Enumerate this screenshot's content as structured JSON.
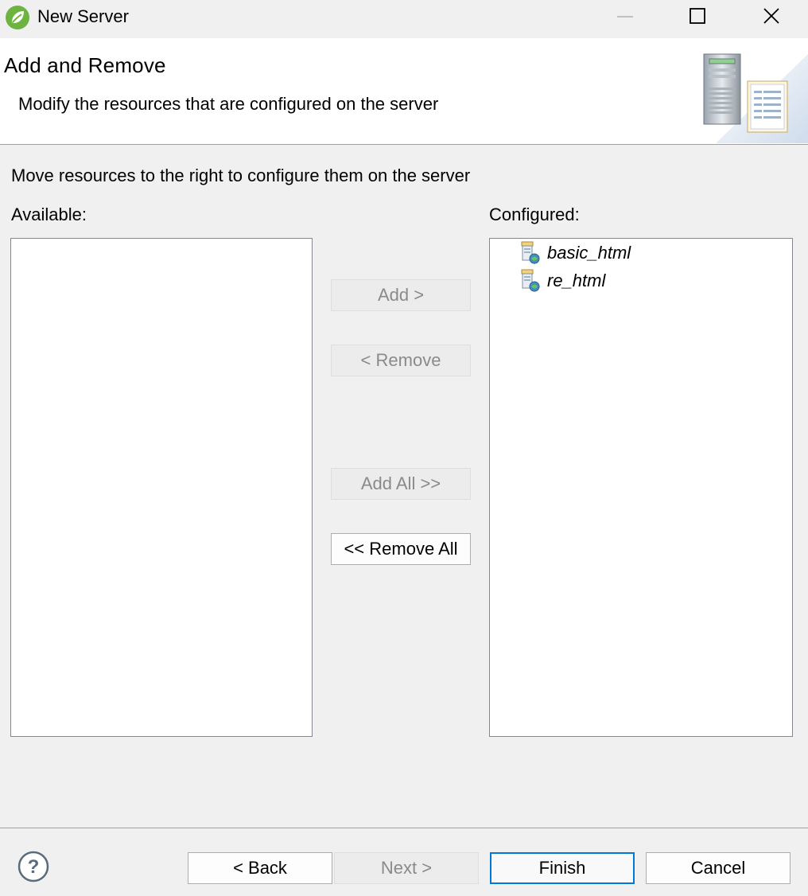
{
  "window": {
    "title": "New Server",
    "icons": {
      "app": "spring-leaf-icon",
      "minimize": "minimize-icon",
      "maximize": "maximize-icon",
      "close": "close-icon"
    }
  },
  "header": {
    "title": "Add and Remove",
    "description": "Modify the resources that are configured on the server",
    "graphic": "server-banner-icon"
  },
  "body": {
    "instruction": "Move resources to the right to configure them on the server",
    "available_label": "Available:",
    "configured_label": "Configured:",
    "available_items": [],
    "configured_items": [
      {
        "label": "basic_html",
        "icon": "web-module-icon"
      },
      {
        "label": "re_html",
        "icon": "web-module-icon"
      }
    ]
  },
  "buttons": {
    "add": "Add >",
    "remove": "< Remove",
    "add_all": "Add All >>",
    "remove_all": "<< Remove All"
  },
  "footer": {
    "help_icon": "help-icon",
    "back": "< Back",
    "next": "Next >",
    "finish": "Finish",
    "cancel": "Cancel"
  },
  "colors": {
    "focus_border": "#0078d7",
    "disabled_text": "#8a8a8a",
    "spring_green": "#6db33f"
  }
}
